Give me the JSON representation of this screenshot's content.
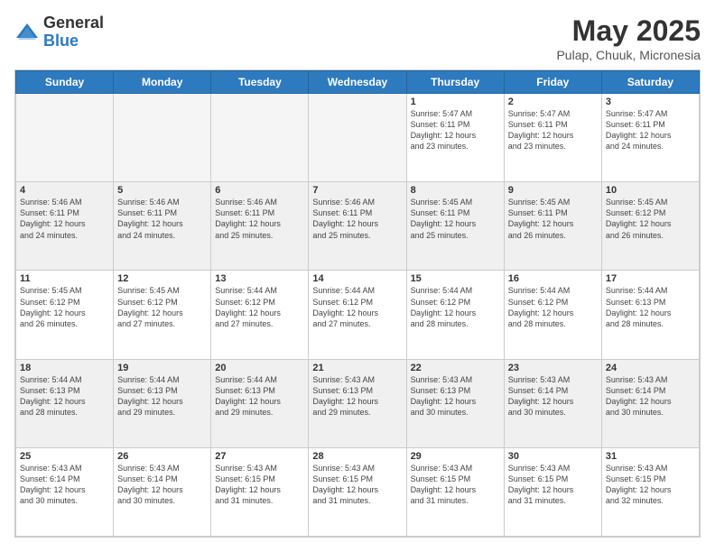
{
  "logo": {
    "general": "General",
    "blue": "Blue"
  },
  "title": "May 2025",
  "location": "Pulap, Chuuk, Micronesia",
  "headers": [
    "Sunday",
    "Monday",
    "Tuesday",
    "Wednesday",
    "Thursday",
    "Friday",
    "Saturday"
  ],
  "weeks": [
    [
      {
        "day": "",
        "info": "",
        "empty": true
      },
      {
        "day": "",
        "info": "",
        "empty": true
      },
      {
        "day": "",
        "info": "",
        "empty": true
      },
      {
        "day": "",
        "info": "",
        "empty": true
      },
      {
        "day": "1",
        "info": "Sunrise: 5:47 AM\nSunset: 6:11 PM\nDaylight: 12 hours\nand 23 minutes.",
        "empty": false
      },
      {
        "day": "2",
        "info": "Sunrise: 5:47 AM\nSunset: 6:11 PM\nDaylight: 12 hours\nand 23 minutes.",
        "empty": false
      },
      {
        "day": "3",
        "info": "Sunrise: 5:47 AM\nSunset: 6:11 PM\nDaylight: 12 hours\nand 24 minutes.",
        "empty": false
      }
    ],
    [
      {
        "day": "4",
        "info": "Sunrise: 5:46 AM\nSunset: 6:11 PM\nDaylight: 12 hours\nand 24 minutes.",
        "empty": false
      },
      {
        "day": "5",
        "info": "Sunrise: 5:46 AM\nSunset: 6:11 PM\nDaylight: 12 hours\nand 24 minutes.",
        "empty": false
      },
      {
        "day": "6",
        "info": "Sunrise: 5:46 AM\nSunset: 6:11 PM\nDaylight: 12 hours\nand 25 minutes.",
        "empty": false
      },
      {
        "day": "7",
        "info": "Sunrise: 5:46 AM\nSunset: 6:11 PM\nDaylight: 12 hours\nand 25 minutes.",
        "empty": false
      },
      {
        "day": "8",
        "info": "Sunrise: 5:45 AM\nSunset: 6:11 PM\nDaylight: 12 hours\nand 25 minutes.",
        "empty": false
      },
      {
        "day": "9",
        "info": "Sunrise: 5:45 AM\nSunset: 6:11 PM\nDaylight: 12 hours\nand 26 minutes.",
        "empty": false
      },
      {
        "day": "10",
        "info": "Sunrise: 5:45 AM\nSunset: 6:12 PM\nDaylight: 12 hours\nand 26 minutes.",
        "empty": false
      }
    ],
    [
      {
        "day": "11",
        "info": "Sunrise: 5:45 AM\nSunset: 6:12 PM\nDaylight: 12 hours\nand 26 minutes.",
        "empty": false
      },
      {
        "day": "12",
        "info": "Sunrise: 5:45 AM\nSunset: 6:12 PM\nDaylight: 12 hours\nand 27 minutes.",
        "empty": false
      },
      {
        "day": "13",
        "info": "Sunrise: 5:44 AM\nSunset: 6:12 PM\nDaylight: 12 hours\nand 27 minutes.",
        "empty": false
      },
      {
        "day": "14",
        "info": "Sunrise: 5:44 AM\nSunset: 6:12 PM\nDaylight: 12 hours\nand 27 minutes.",
        "empty": false
      },
      {
        "day": "15",
        "info": "Sunrise: 5:44 AM\nSunset: 6:12 PM\nDaylight: 12 hours\nand 28 minutes.",
        "empty": false
      },
      {
        "day": "16",
        "info": "Sunrise: 5:44 AM\nSunset: 6:12 PM\nDaylight: 12 hours\nand 28 minutes.",
        "empty": false
      },
      {
        "day": "17",
        "info": "Sunrise: 5:44 AM\nSunset: 6:13 PM\nDaylight: 12 hours\nand 28 minutes.",
        "empty": false
      }
    ],
    [
      {
        "day": "18",
        "info": "Sunrise: 5:44 AM\nSunset: 6:13 PM\nDaylight: 12 hours\nand 28 minutes.",
        "empty": false
      },
      {
        "day": "19",
        "info": "Sunrise: 5:44 AM\nSunset: 6:13 PM\nDaylight: 12 hours\nand 29 minutes.",
        "empty": false
      },
      {
        "day": "20",
        "info": "Sunrise: 5:44 AM\nSunset: 6:13 PM\nDaylight: 12 hours\nand 29 minutes.",
        "empty": false
      },
      {
        "day": "21",
        "info": "Sunrise: 5:43 AM\nSunset: 6:13 PM\nDaylight: 12 hours\nand 29 minutes.",
        "empty": false
      },
      {
        "day": "22",
        "info": "Sunrise: 5:43 AM\nSunset: 6:13 PM\nDaylight: 12 hours\nand 30 minutes.",
        "empty": false
      },
      {
        "day": "23",
        "info": "Sunrise: 5:43 AM\nSunset: 6:14 PM\nDaylight: 12 hours\nand 30 minutes.",
        "empty": false
      },
      {
        "day": "24",
        "info": "Sunrise: 5:43 AM\nSunset: 6:14 PM\nDaylight: 12 hours\nand 30 minutes.",
        "empty": false
      }
    ],
    [
      {
        "day": "25",
        "info": "Sunrise: 5:43 AM\nSunset: 6:14 PM\nDaylight: 12 hours\nand 30 minutes.",
        "empty": false
      },
      {
        "day": "26",
        "info": "Sunrise: 5:43 AM\nSunset: 6:14 PM\nDaylight: 12 hours\nand 30 minutes.",
        "empty": false
      },
      {
        "day": "27",
        "info": "Sunrise: 5:43 AM\nSunset: 6:15 PM\nDaylight: 12 hours\nand 31 minutes.",
        "empty": false
      },
      {
        "day": "28",
        "info": "Sunrise: 5:43 AM\nSunset: 6:15 PM\nDaylight: 12 hours\nand 31 minutes.",
        "empty": false
      },
      {
        "day": "29",
        "info": "Sunrise: 5:43 AM\nSunset: 6:15 PM\nDaylight: 12 hours\nand 31 minutes.",
        "empty": false
      },
      {
        "day": "30",
        "info": "Sunrise: 5:43 AM\nSunset: 6:15 PM\nDaylight: 12 hours\nand 31 minutes.",
        "empty": false
      },
      {
        "day": "31",
        "info": "Sunrise: 5:43 AM\nSunset: 6:15 PM\nDaylight: 12 hours\nand 32 minutes.",
        "empty": false
      }
    ]
  ]
}
